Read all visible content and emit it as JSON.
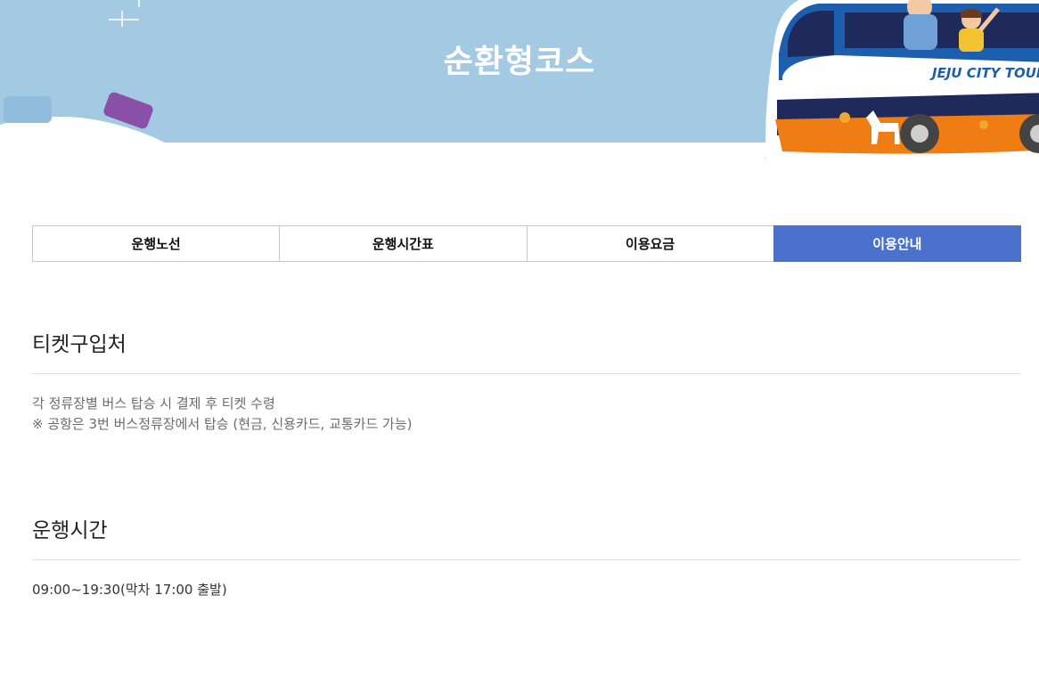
{
  "hero": {
    "title": "순환형코스",
    "bus_text": "JEJU CITY TOUR",
    "colors": {
      "sky": "#a3c9e3",
      "bus_blue": "#1d5fae",
      "bus_orange": "#f07d13",
      "navy": "#1f2a5c"
    }
  },
  "tabs": [
    {
      "label": "운행노선",
      "active": false
    },
    {
      "label": "운행시간표",
      "active": false
    },
    {
      "label": "이용요금",
      "active": false
    },
    {
      "label": "이용안내",
      "active": true
    }
  ],
  "accent_color": "#4a72cc",
  "sections": {
    "ticket": {
      "heading": "티켓구입처",
      "line1": "각 정류장별 버스 탑승 시 결제 후 티켓 수령",
      "line2": "※ 공항은 3번 버스정류장에서 탑승 (현금, 신용카드, 교통카드 가능)"
    },
    "hours": {
      "heading": "운행시간",
      "line1": "09:00~19:30(막차 17:00 출발)"
    }
  }
}
